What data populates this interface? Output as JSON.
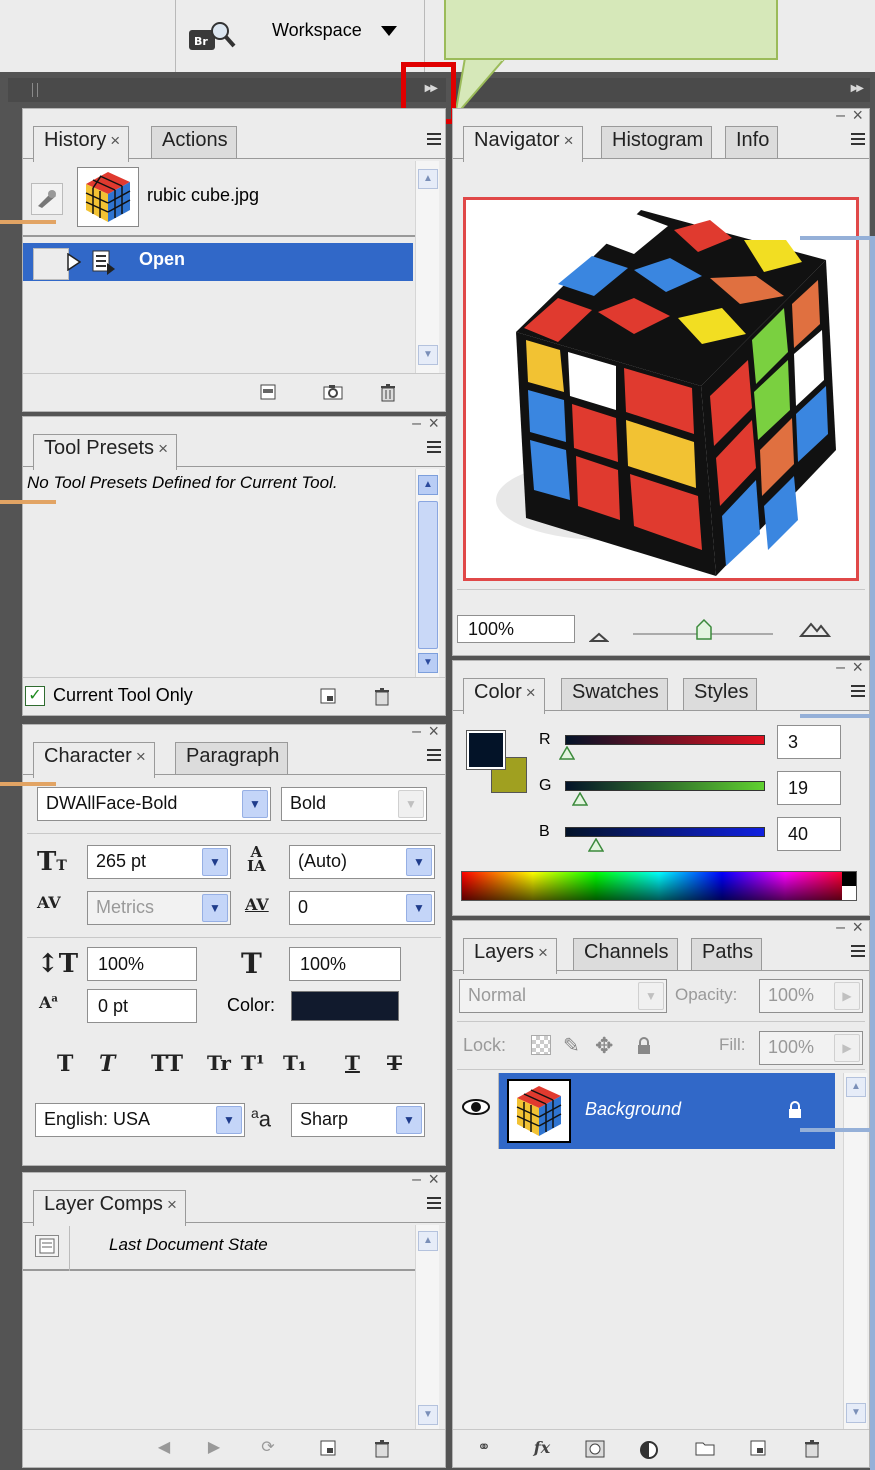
{
  "top_bar": {
    "workspace_label": "Workspace"
  },
  "history": {
    "tabs": [
      "History",
      "Actions"
    ],
    "snapshot_name": "rubic cube.jpg",
    "step": "Open"
  },
  "tool_presets": {
    "tab": "Tool Presets",
    "empty_message": "No Tool Presets Defined for Current Tool.",
    "checkbox_label": "Current Tool Only",
    "checkbox_checked": true
  },
  "character": {
    "tabs": [
      "Character",
      "Paragraph"
    ],
    "font_family": "DWAllFace-Bold",
    "font_style": "Bold",
    "font_size": "265 pt",
    "leading": "(Auto)",
    "kerning": "Metrics",
    "tracking": "0",
    "vertical_scale": "100%",
    "horizontal_scale": "100%",
    "baseline_shift": "0 pt",
    "color_label": "Color:",
    "color_swatch": "#111a2d",
    "style_buttons": [
      "T",
      "T",
      "TT",
      "Tr",
      "T¹",
      "T₁",
      "T",
      "T"
    ],
    "language": "English: USA",
    "aa_icon_text": "a",
    "aa_icon_text_big": "a",
    "anti_alias": "Sharp"
  },
  "layer_comps": {
    "tab": "Layer Comps",
    "state": "Last Document State"
  },
  "navigator": {
    "tabs": [
      "Navigator",
      "Histogram",
      "Info"
    ],
    "zoom": "100%"
  },
  "color": {
    "tabs": [
      "Color",
      "Swatches",
      "Styles"
    ],
    "foreground": "#031328",
    "background": "#a0a020",
    "r_label": "R",
    "r_value": "3",
    "r_fraction": 0.012,
    "g_label": "G",
    "g_value": "19",
    "g_fraction": 0.075,
    "b_label": "B",
    "b_value": "40",
    "b_fraction": 0.157
  },
  "layers": {
    "tabs": [
      "Layers",
      "Channels",
      "Paths"
    ],
    "blend_mode": "Normal",
    "opacity_label": "Opacity:",
    "opacity": "100%",
    "lock_label": "Lock:",
    "fill_label": "Fill:",
    "fill": "100%",
    "layer_name": "Background",
    "footer_fx": "fx"
  }
}
